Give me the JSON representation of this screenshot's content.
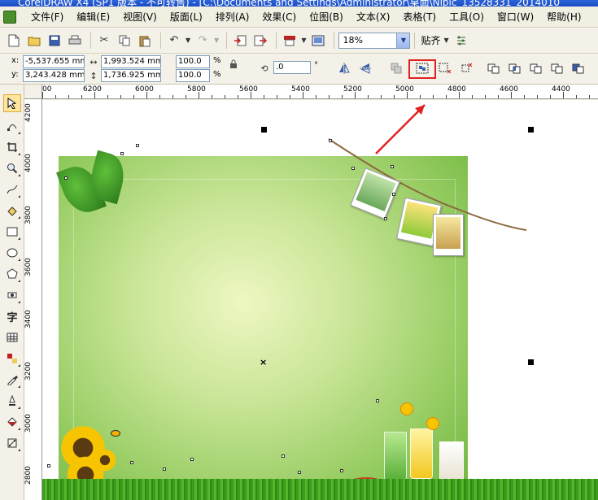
{
  "app": {
    "title_fragment": "CorelDRAW X4 (SP1 版本 - 不可转售) - [C:\\Documents and Settings\\Administrator\\桌面\\Nipic_13528331_2014010"
  },
  "menu": {
    "items": [
      "文件(F)",
      "编辑(E)",
      "视图(V)",
      "版面(L)",
      "排列(A)",
      "效果(C)",
      "位图(B)",
      "文本(X)",
      "表格(T)",
      "工具(O)",
      "窗口(W)",
      "帮助(H)"
    ]
  },
  "toolbar": {
    "zoom_value": "18%",
    "snap_label": "贴齐"
  },
  "property_bar": {
    "x_label": "x:",
    "y_label": "y:",
    "x_value": "-5,537.655 mm",
    "y_value": "3,243.428 mm",
    "width_value": "1,993.524 mm",
    "height_value": "1,736.925 mm",
    "scale_x": "100.0",
    "scale_y": "100.0",
    "percent": "%",
    "rotation_value": ".0",
    "degree": "°"
  },
  "ruler": {
    "top_labels": [
      "00",
      "6200",
      "6000",
      "5800",
      "5600",
      "5400",
      "5200",
      "5000",
      "4800",
      "4600",
      "4400"
    ],
    "left_labels": [
      "4200",
      "4000",
      "3800",
      "3600",
      "3400",
      "3200",
      "3000",
      "2800"
    ]
  },
  "toolbox": {
    "tools": [
      "pick-tool",
      "shape-tool",
      "crop-tool",
      "zoom-tool",
      "freehand-tool",
      "smart-fill-tool",
      "rectangle-tool",
      "ellipse-tool",
      "polygon-tool",
      "basic-shapes-tool",
      "text-tool",
      "table-tool",
      "interactive-blend-tool",
      "eyedropper-tool",
      "outline-tool",
      "fill-tool",
      "interactive-fill-tool"
    ]
  },
  "colors": {
    "highlight": "#e02020",
    "artwork_green": "#96cc62"
  }
}
